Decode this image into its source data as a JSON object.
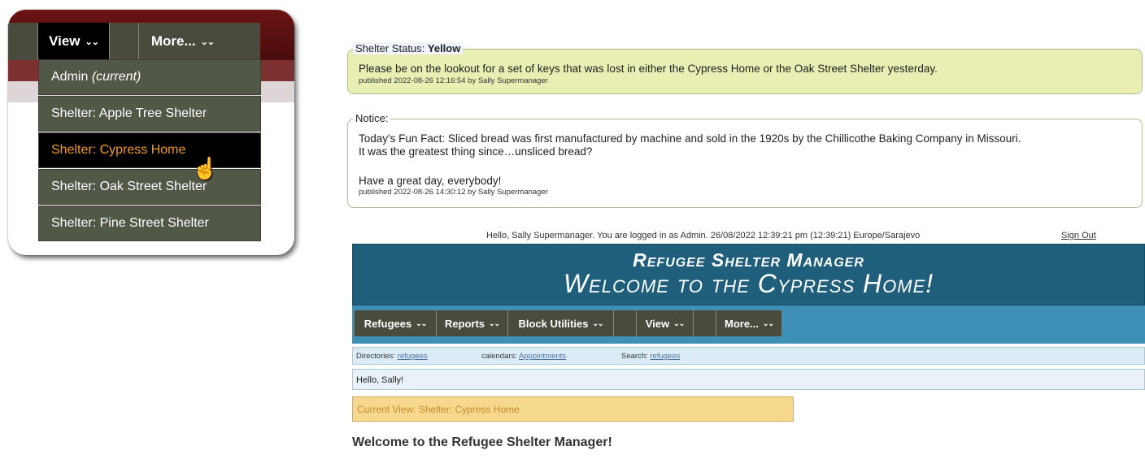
{
  "callout": {
    "view_label": "View",
    "more_label": "More...",
    "chevron": "⌵",
    "items": [
      {
        "label": "Admin",
        "suffix": "(current)"
      },
      {
        "label": "Shelter: Apple Tree Shelter"
      },
      {
        "label": "Shelter: Cypress Home"
      },
      {
        "label": "Shelter: Oak Street Shelter"
      },
      {
        "label": "Shelter: Pine Street Shelter"
      }
    ],
    "cursor_icon": "hand-pointer-icon"
  },
  "status_box": {
    "legend_prefix": "Shelter Status: ",
    "legend_value": "Yellow",
    "message": "Please be on the lookout for a set of keys that was lost in either the Cypress Home or the Oak Street Shelter yesterday.",
    "published": "published 2022-08-26 12:16:54 by Sally Supermanager"
  },
  "notice_box": {
    "legend": "Notice:",
    "line1": "Today's Fun Fact: Sliced bread was first manufactured by machine and sold in the 1920s by the Chillicothe Baking Company in Missouri.",
    "line2": "It was the greatest thing since…unsliced bread?",
    "line3": "Have a great day, everybody!",
    "published": "published 2022-08-26 14:30:12 by Sally Supermanager"
  },
  "header": {
    "hello_text": "Hello, Sally Supermanager. You are logged in as Admin. 26/08/2022 12:39:21 pm (12:39:21) Europe/Sarajevo",
    "signout": "Sign Out",
    "app_title": "Refugee Shelter Manager",
    "welcome_title": "Welcome to the Cypress Home!"
  },
  "menubar": {
    "items": [
      "Refugees",
      "Reports",
      "Block Utilities",
      "View",
      "More..."
    ]
  },
  "dirbar": {
    "directories_label": "Directories:",
    "directories_link": "refugees",
    "calendars_label": "calendars:",
    "calendars_link": "Appointments",
    "search_label": "Search:",
    "search_link": "refugees"
  },
  "hello_sally": "Hello, Sally!",
  "current_view": "Current View: Shelter: Cypress Home",
  "welcome_heading": "Welcome to the Refugee Shelter Manager!",
  "colors": {
    "maroon": "#6b1414",
    "menu_olive": "#525847",
    "active_orange": "#f29b1e",
    "banner_blue": "#1f5f7c",
    "menubar_blue": "#3f90b6",
    "status_yellow": "#e9eeb3",
    "current_view_bg": "#f7d88f"
  }
}
